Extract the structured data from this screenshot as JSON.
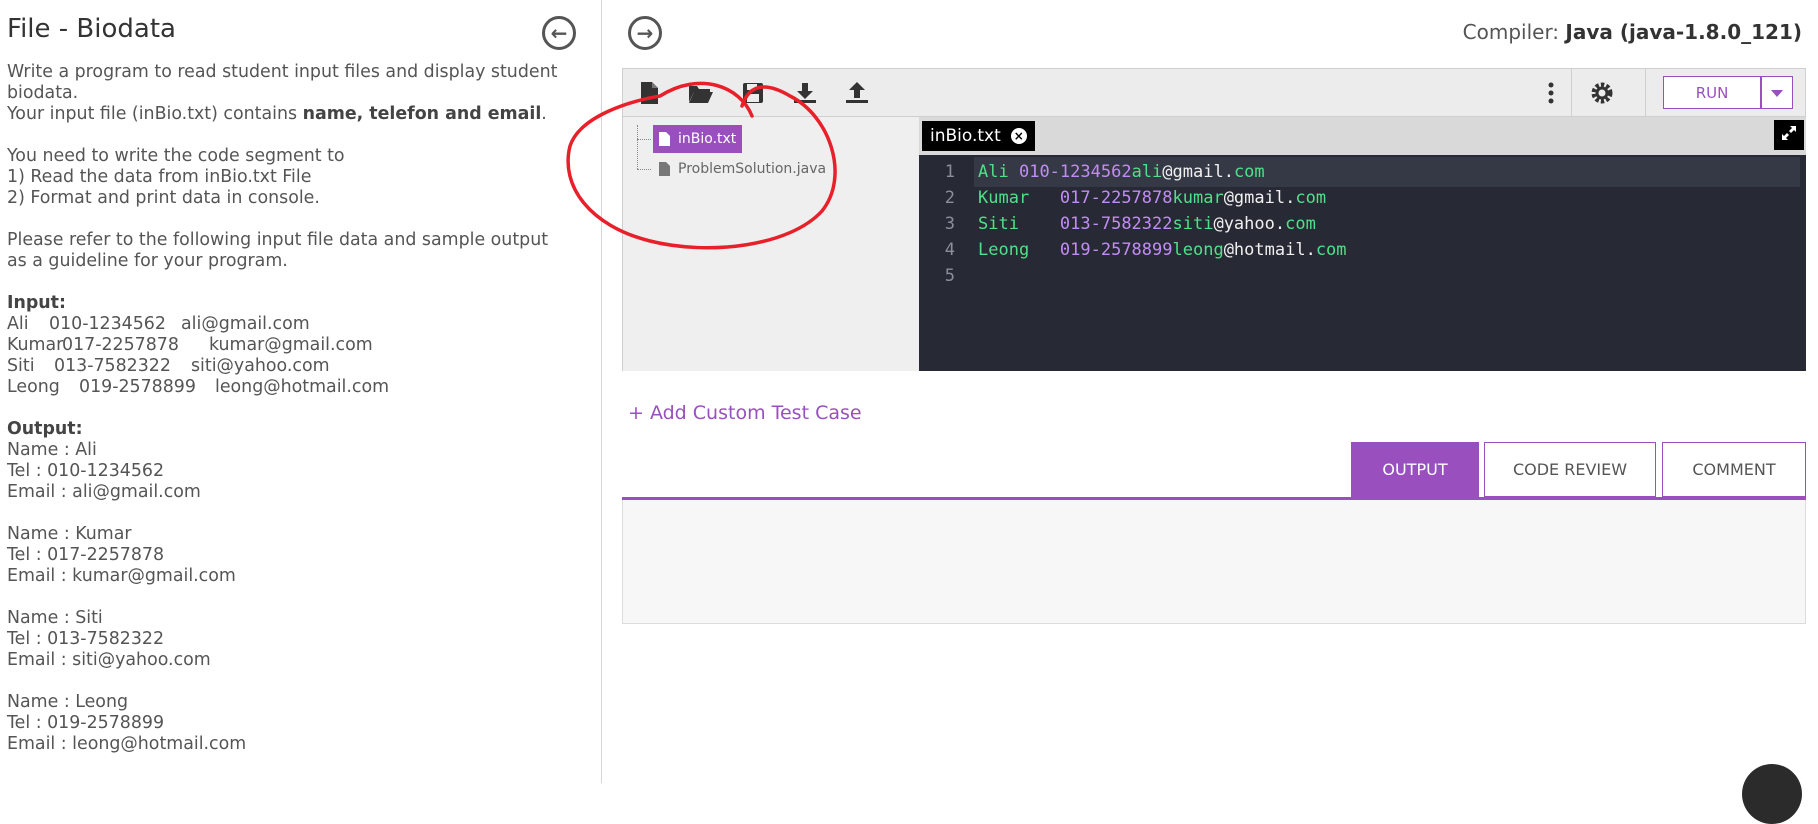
{
  "problem": {
    "title": "File - Biodata",
    "intro_line1": "Write a program to read student input files and display student biodata.",
    "intro_line2_pre": "Your input file (inBio.txt) contains ",
    "intro_line2_bold": "name, telefon and email",
    "intro_line2_post": ".",
    "task_line": "You need to write the code segment to",
    "task_step1": "1) Read the data from inBio.txt File",
    "task_step2": "2) Format and print data in console.",
    "refer_line": "Please refer to the following input file data and sample output as a guideline for your program.",
    "input_label": "Input:",
    "input_rows": [
      {
        "name": "Ali",
        "tel": "010-1234562",
        "email": "ali@gmail.com"
      },
      {
        "name": "Kumar",
        "tel": "017-2257878",
        "email": "kumar@gmail.com"
      },
      {
        "name": "Siti",
        "tel": "013-7582322",
        "email": "siti@yahoo.com"
      },
      {
        "name": "Leong",
        "tel": "019-2578899",
        "email": "leong@hotmail.com"
      }
    ],
    "output_label": "Output:",
    "output_blocks": [
      {
        "name": "Name : Ali",
        "tel": "Tel : 010-1234562",
        "email": "Email : ali@gmail.com"
      },
      {
        "name": "Name : Kumar",
        "tel": "Tel : 017-2257878",
        "email": "Email : kumar@gmail.com"
      },
      {
        "name": "Name : Siti",
        "tel": "Tel : 013-7582322",
        "email": "Email : siti@yahoo.com"
      },
      {
        "name": "Name : Leong",
        "tel": "Tel : 019-2578899",
        "email": "Email : leong@hotmail.com"
      }
    ]
  },
  "compiler": {
    "label": "Compiler: ",
    "value": "Java (java-1.8.0_121)"
  },
  "toolbar": {
    "run_label": "RUN"
  },
  "file_tree": {
    "files": [
      {
        "name": "inBio.txt",
        "selected": true
      },
      {
        "name": "ProblemSolution.java",
        "selected": false
      }
    ]
  },
  "editor": {
    "tab_label": "inBio.txt",
    "lines": [
      {
        "num": "1",
        "name": "Ali",
        "pad": " ",
        "tel": "010-1234562",
        "user": "ali",
        "domain": "@gmail.",
        "tld": "com"
      },
      {
        "num": "2",
        "name": "Kumar",
        "pad": "   ",
        "tel": "017-2257878",
        "user": "kumar",
        "domain": "@gmail.",
        "tld": "com"
      },
      {
        "num": "3",
        "name": "Siti",
        "pad": "    ",
        "tel": "013-7582322",
        "user": "siti",
        "domain": "@yahoo.",
        "tld": "com"
      },
      {
        "num": "4",
        "name": "Leong",
        "pad": "   ",
        "tel": "019-2578899",
        "user": "leong",
        "domain": "@hotmail.",
        "tld": "com"
      },
      {
        "num": "5",
        "name": "",
        "pad": "",
        "tel": "",
        "user": "",
        "domain": "",
        "tld": ""
      }
    ]
  },
  "add_case": {
    "label": "+ Add Custom Test Case"
  },
  "result_tabs": [
    {
      "label": "OUTPUT",
      "active": true
    },
    {
      "label": "CODE REVIEW",
      "active": false
    },
    {
      "label": "COMMENT",
      "active": false
    }
  ],
  "colors": {
    "accent": "#9a4fbf",
    "annotation": "#e8202a",
    "editor_bg": "#272a35"
  }
}
